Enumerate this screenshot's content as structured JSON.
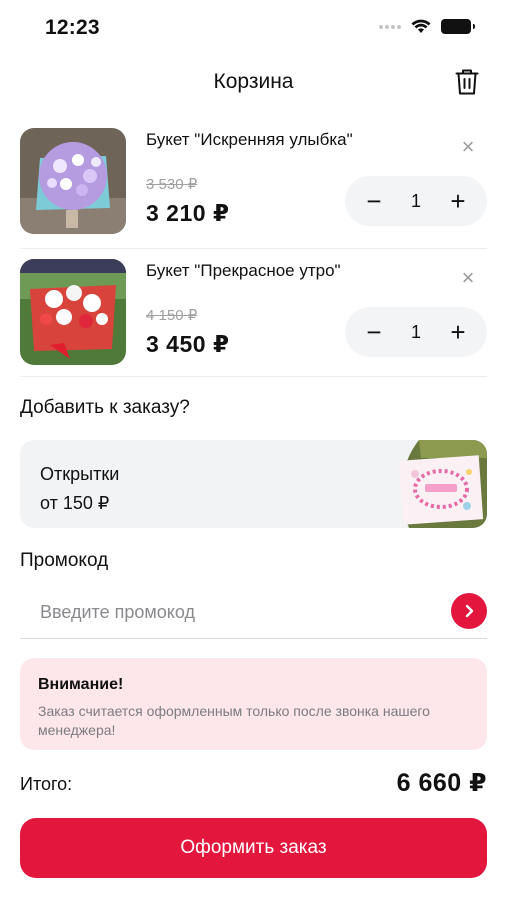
{
  "status_bar": {
    "time": "12:23"
  },
  "header": {
    "title": "Корзина",
    "trash_icon": "trash-icon"
  },
  "cart": {
    "items": [
      {
        "name": "Букет \"Искренняя улыбка\"",
        "old_price": "3 530 ₽",
        "price": "3 210 ₽",
        "quantity": "1"
      },
      {
        "name": "Букет \"Прекрасное утро\"",
        "old_price": "4 150 ₽",
        "price": "3 450 ₽",
        "quantity": "1"
      }
    ],
    "minus_symbol": "−",
    "plus_symbol": "+",
    "remove_symbol": "×"
  },
  "addons": {
    "title": "Добавить к заказу?",
    "card": {
      "name": "Открытки",
      "price": "от 150 ₽"
    }
  },
  "promo": {
    "title": "Промокод",
    "placeholder": "Введите промокод",
    "value": ""
  },
  "alert": {
    "title": "Внимание!",
    "text": "Заказ считается оформленным только после звонка нашего менеджера!"
  },
  "total": {
    "label": "Итого:",
    "value": "6 660 ₽"
  },
  "checkout": {
    "label": "Оформить заказ"
  },
  "colors": {
    "accent": "#e3173e",
    "card_bg": "#f2f3f5",
    "alert_bg": "#fde7ea",
    "muted_text": "#a0a0a0"
  }
}
